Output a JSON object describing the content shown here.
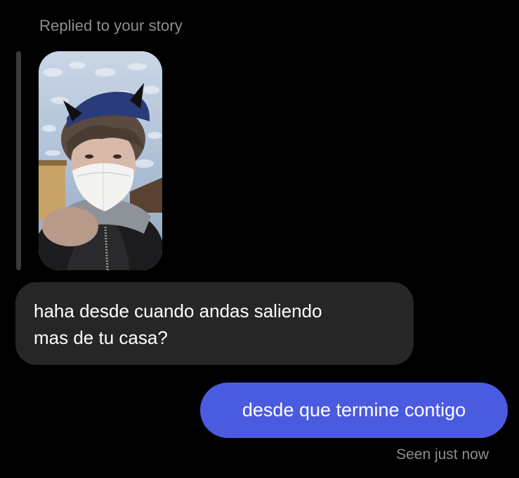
{
  "story_reply": {
    "caption": "Replied to your story",
    "thumbnail_icon": "story-photo-thumbnail"
  },
  "messages": [
    {
      "direction": "incoming",
      "lines": [
        "haha desde cuando andas saliendo",
        "mas de tu casa?"
      ]
    },
    {
      "direction": "outgoing",
      "text": "desde que termine contigo"
    }
  ],
  "status": {
    "seen": "Seen just now"
  },
  "colors": {
    "background": "#000000",
    "incoming_bubble": "#262626",
    "outgoing_bubble": "#4a5be0",
    "muted_text": "#8e8e93"
  }
}
